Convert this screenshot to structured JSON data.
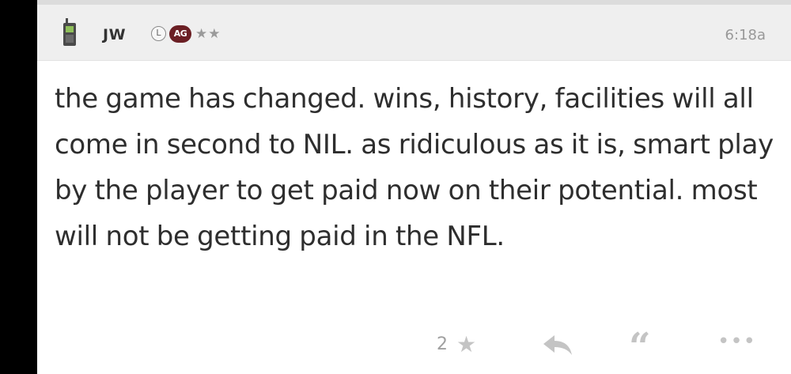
{
  "post": {
    "username": "JW",
    "badge_l": "L",
    "badge_ag": "AG",
    "stars": "★★",
    "timestamp": "6:18a",
    "body": "the game has changed. wins, history, facilities will all come in second to NIL. as ridiculous as it is, smart play by the player to get paid now on their potential. most will not be getting paid in the NFL.",
    "like_count": "2",
    "icons": {
      "device": "mobile-phone-icon",
      "like": "star-icon",
      "reply": "reply-arrow-icon",
      "quote": "quote-icon",
      "more": "more-dots-icon"
    }
  },
  "colors": {
    "header_bg": "#efefef",
    "badge_ag_bg": "#6b1f24",
    "text": "#2e2e2e",
    "muted": "#999999",
    "icon_gray": "#c4c4c4"
  }
}
